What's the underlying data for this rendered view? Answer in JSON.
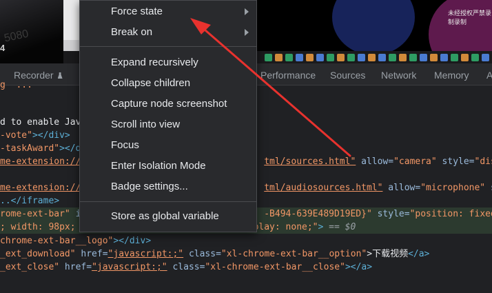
{
  "preview": {
    "left_number": "4",
    "left_faint_text": "5080",
    "caption": "未经授权严禁录制录制"
  },
  "tabs": {
    "recorder": "Recorder",
    "performance": "Performance",
    "sources": "Sources",
    "network": "Network",
    "memory": "Memory",
    "overflow": "A"
  },
  "code_lines": {
    "l0": "g  ...",
    "l1": "d to enable Java",
    "l2a": "-vote\"",
    "l2b": "></div>",
    "l3a": "-taskAward\"",
    "l3b": "></d",
    "l4a": "me-extension://k",
    "l4b": "tml/sources.html\"",
    "l4c": " allow=",
    "l4d": "\"camera\"",
    "l4e": " style=",
    "l4f": "\"displa",
    "l5a": "me-extension://k",
    "l5b": "tml/audiosources.html\"",
    "l5c": " allow=",
    "l5d": "\"microphone\"",
    "l5e": " styl",
    "l6": "..</iframe>",
    "l7a": "rome-ext-bar\"",
    "l7b": " id",
    "l7c": "-B494-639E489D19ED}\"",
    "l7d": " style=",
    "l7e": "\"position: fixed; l",
    "l8a": "; width: 98px;",
    "l8b": "play: none;\"",
    "l8c": "> ",
    "l8d": "== $0",
    "l9a": "chrome-ext-bar__logo\"",
    "l9b": "></div>",
    "l10a": "_ext_download\"",
    "l10b": " href=",
    "l10c": "\"javascript:;\"",
    "l10d": " class=",
    "l10e": "\"xl-chrome-ext-bar__option\"",
    "l10f": ">下载视频",
    "l10g": "</a>",
    "l11a": "_ext_close\"",
    "l11b": " href=",
    "l11c": "\"javascript:;\"",
    "l11d": " class=",
    "l11e": "\"xl-chrome-ext-bar__close\"",
    "l11f": "></a>"
  },
  "menu": {
    "force_state": "Force state",
    "break_on": "Break on",
    "expand_recursively": "Expand recursively",
    "collapse_children": "Collapse children",
    "capture_node_screenshot": "Capture node screenshot",
    "scroll_into_view": "Scroll into view",
    "focus": "Focus",
    "enter_isolation_mode": "Enter Isolation Mode",
    "badge_settings": "Badge settings...",
    "store_as_global_variable": "Store as global variable"
  },
  "icons": {
    "recorder_tab_icon": "flask-icon",
    "submenu_icon": "chevron-right-icon",
    "annotation": "red-arrow-icon"
  },
  "colors": {
    "menu_bg": "#292a2d",
    "annotation_arrow": "#e8322e",
    "selected_row": "#2c3a2f"
  }
}
